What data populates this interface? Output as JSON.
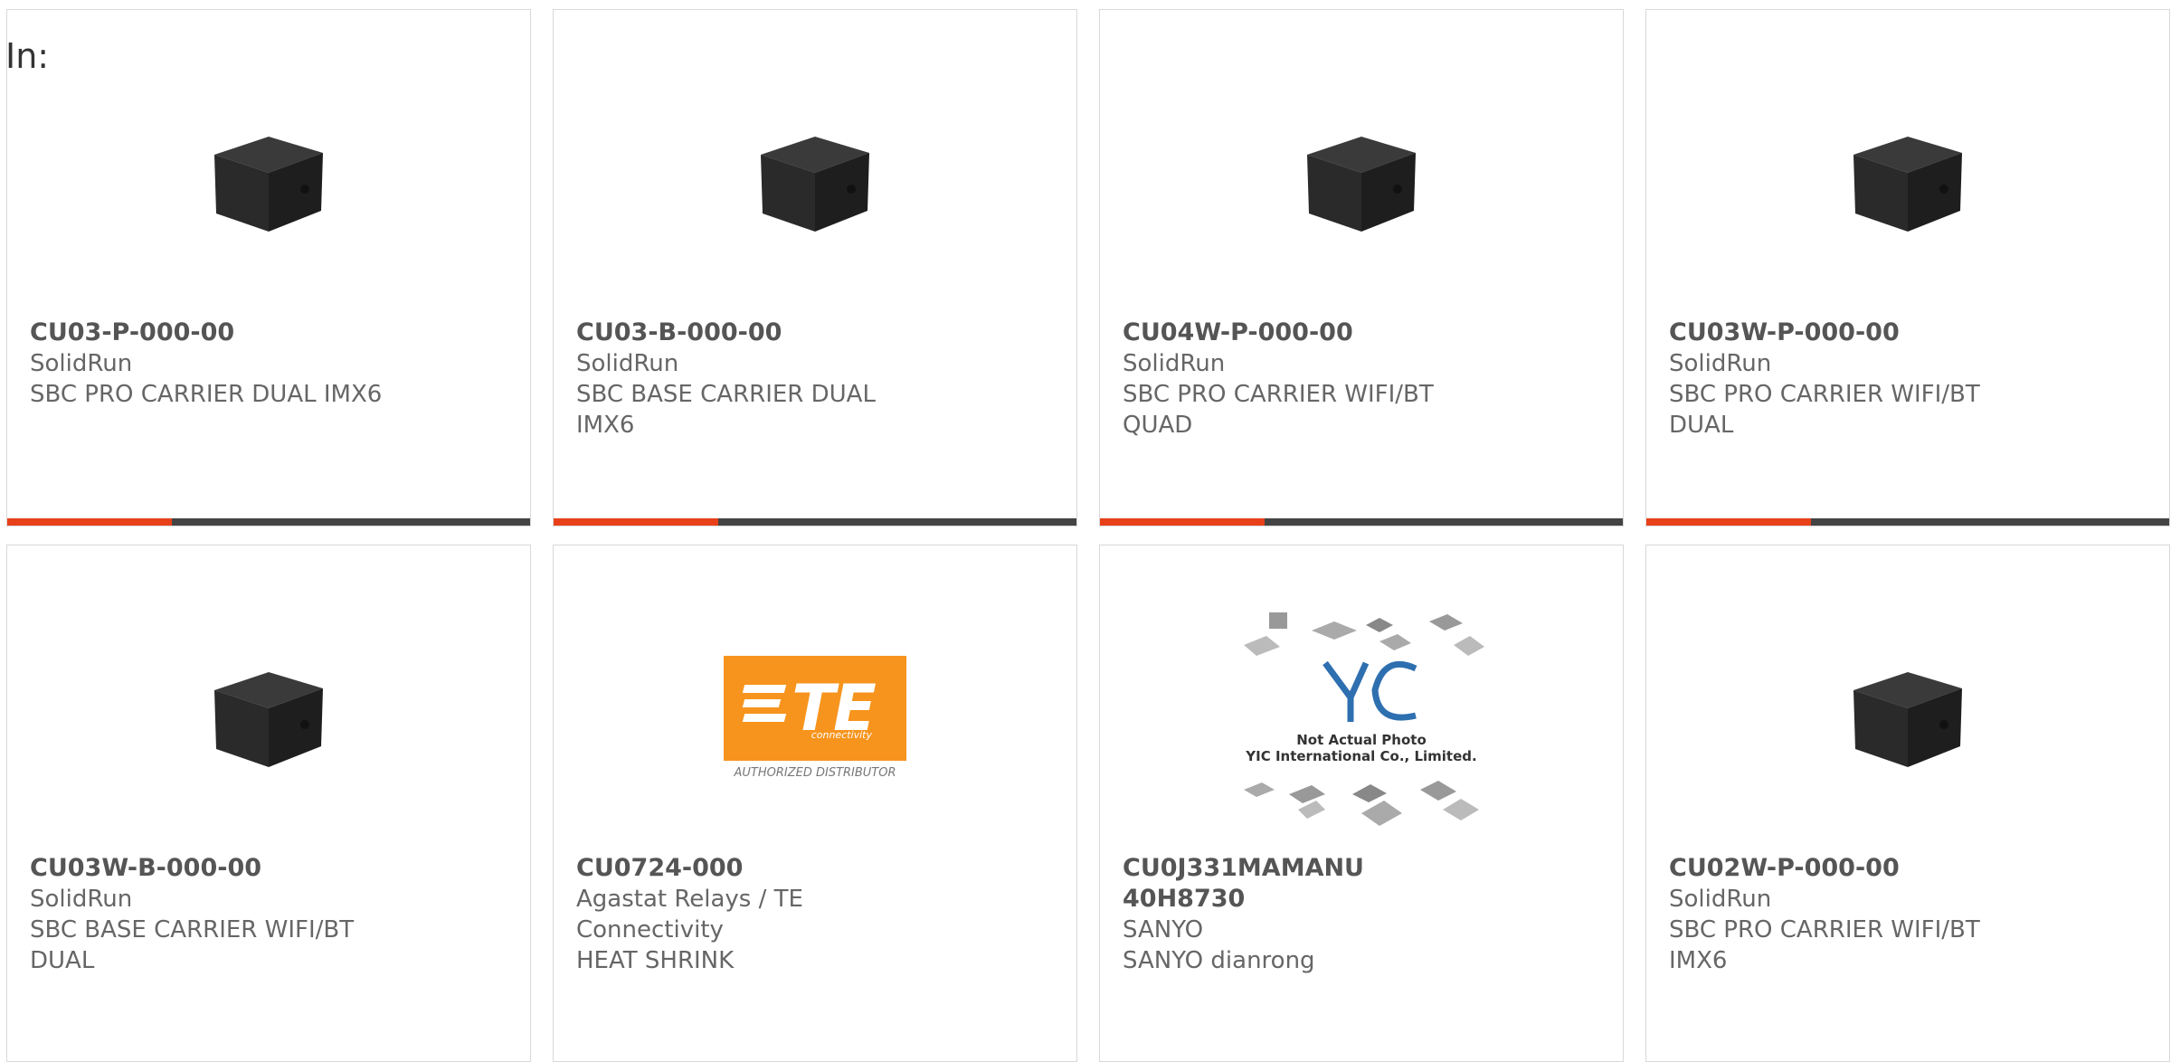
{
  "header": {
    "in_label": "In:"
  },
  "colors": {
    "accent": "#e8411a",
    "bar": "#444444",
    "te_orange": "#f7941d"
  },
  "products": [
    {
      "part": "CU03-P-000-00",
      "manufacturer": "SolidRun",
      "description": "SBC PRO CARRIER DUAL IMX6",
      "image": "cubox-icon"
    },
    {
      "part": "CU03-B-000-00",
      "manufacturer": "SolidRun",
      "description": "SBC BASE CARRIER DUAL IMX6",
      "image": "cubox-icon"
    },
    {
      "part": "CU04W-P-000-00",
      "manufacturer": "SolidRun",
      "description": "SBC PRO CARRIER WIFI/BT QUAD",
      "image": "cubox-icon"
    },
    {
      "part": "CU03W-P-000-00",
      "manufacturer": "SolidRun",
      "description": "SBC PRO CARRIER WIFI/BT DUAL",
      "image": "cubox-icon"
    },
    {
      "part": "CU03W-B-000-00",
      "manufacturer": "SolidRun",
      "description": "SBC BASE CARRIER WIFI/BT DUAL",
      "image": "cubox-icon"
    },
    {
      "part": "CU0724-000",
      "manufacturer": "Agastat Relays / TE Connectivity",
      "description": "HEAT SHRINK",
      "image": "te-logo",
      "logo_text": "TE",
      "logo_sub": "connectivity",
      "logo_caption": "AUTHORIZED DISTRIBUTOR"
    },
    {
      "part": "CU0J331MAMANU 40H8730",
      "manufacturer": "SANYO",
      "description": "SANYO dianrong",
      "image": "yic-placeholder",
      "logo_line1": "Not Actual Photo",
      "logo_line2": "YIC International Co., Limited."
    },
    {
      "part": "CU02W-P-000-00",
      "manufacturer": "SolidRun",
      "description": "SBC PRO CARRIER WIFI/BT IMX6",
      "image": "cubox-icon"
    }
  ]
}
